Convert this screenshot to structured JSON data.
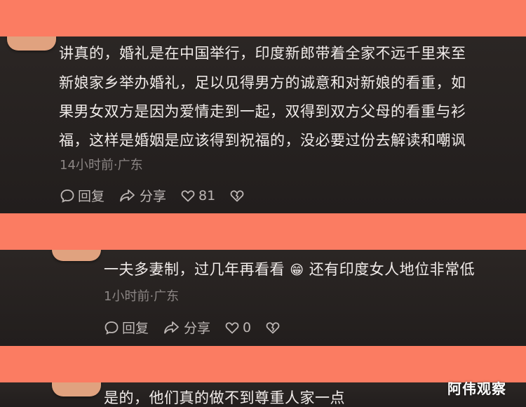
{
  "comments": [
    {
      "lines": [
        "讲真的，婚礼是在中国举行，印度新郎带着全家不远千里来至",
        "新娘家乡举办婚礼，足以见得男方的诚意和对新娘的看重，如",
        "果男女双方是因为爱情走到一起，双得到双方父母的看重与衫",
        "福，这样是婚姻是应该得到祝福的，没必要过份去解读和嘲讽"
      ],
      "meta": "14小时前·广东",
      "reply_label": "回复",
      "share_label": "分享",
      "like_count": "81"
    },
    {
      "text_before_emoji": "一夫多妻制，过几年再看看",
      "emoji": "😁",
      "text_after_emoji": "还有印度女人地位非常低",
      "meta": "1小时前·广东",
      "reply_label": "回复",
      "share_label": "分享",
      "like_count": "0"
    },
    {
      "text": "是的，他们真的做不到尊重人家一点"
    }
  ],
  "watermark": "阿伟观察",
  "colors": {
    "background": "#fb7c62",
    "panel": "#262120",
    "text": "#f1ecea",
    "meta": "#8b8584",
    "action": "#bdb7b5"
  },
  "icons": [
    "comment-icon",
    "share-icon",
    "heart-icon",
    "broken-heart-icon"
  ]
}
